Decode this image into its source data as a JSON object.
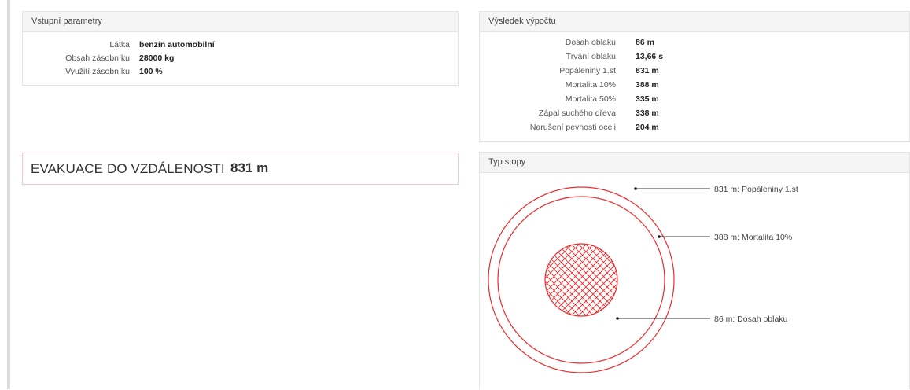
{
  "inputs": {
    "title": "Vstupní parametry",
    "rows": [
      {
        "label": "Látka",
        "value": "benzín automobilní"
      },
      {
        "label": "Obsah zásobníku",
        "value": "28000 kg"
      },
      {
        "label": "Využití zásobníku",
        "value": "100 %"
      }
    ]
  },
  "results": {
    "title": "Výsledek výpočtu",
    "rows": [
      {
        "label": "Dosah oblaku",
        "value": "86 m"
      },
      {
        "label": "Trvání oblaku",
        "value": "13,66 s"
      },
      {
        "label": "Popáleniny 1.st",
        "value": "831 m"
      },
      {
        "label": "Mortalita 10%",
        "value": "388 m"
      },
      {
        "label": "Mortalita 50%",
        "value": "335 m"
      },
      {
        "label": "Zápal suchého dřeva",
        "value": "338 m"
      },
      {
        "label": "Narušení pevnosti oceli",
        "value": "204 m"
      }
    ]
  },
  "evacuation": {
    "label": "EVAKUACE DO VZDÁLENOSTI",
    "value": "831 m"
  },
  "footprint": {
    "title": "Typ stopy",
    "colors": {
      "ring": "#ee2a2a",
      "leader": "#333333"
    },
    "zones": [
      {
        "label": "831 m: Popáleniny 1.st",
        "radius_m": 831,
        "style": "ring"
      },
      {
        "label": "388 m: Mortalita 10%",
        "radius_m": 388,
        "style": "ring"
      },
      {
        "label": "86 m: Dosah oblaku",
        "radius_m": 86,
        "style": "crosshatch"
      }
    ]
  }
}
